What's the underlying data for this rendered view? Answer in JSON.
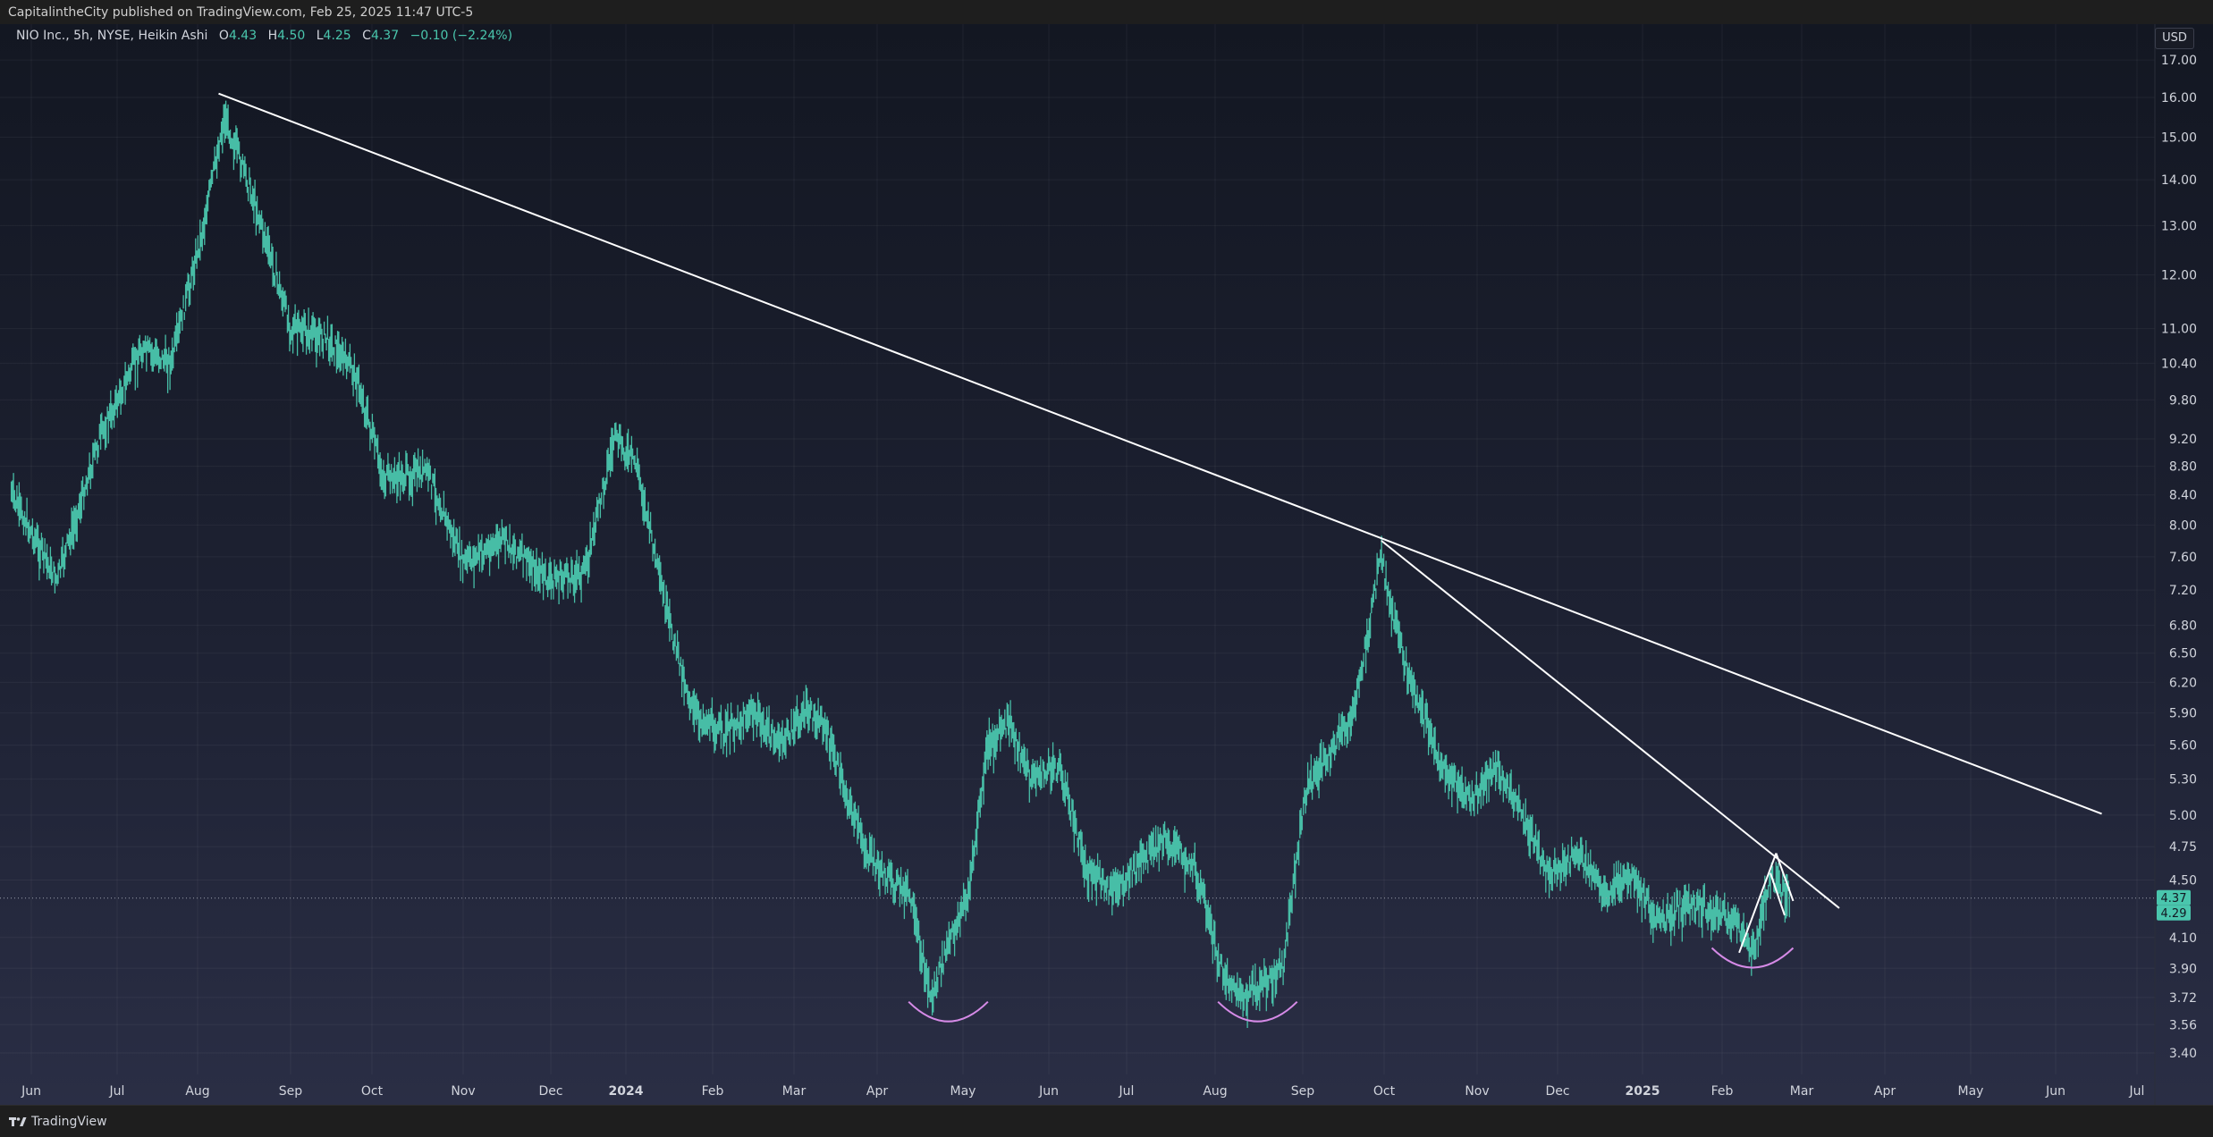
{
  "header": {
    "attribution": "CapitalintheCity published on TradingView.com, Feb 25, 2025 11:47 UTC-5"
  },
  "legend": {
    "symbol": "NIO Inc., 5h, NYSE, Heikin Ashi",
    "open_label": "O",
    "open_value": "4.43",
    "high_label": "H",
    "high_value": "4.50",
    "low_label": "L",
    "low_value": "4.25",
    "close_label": "C",
    "close_value": "4.37",
    "change": "−0.10 (−2.24%)"
  },
  "currency_button": "USD",
  "footer": {
    "brand": "TradingView"
  },
  "colors": {
    "candle": "#4ac6ad",
    "trendline": "#ffffff",
    "arc": "#d58ae6",
    "price_tag": "#4ac6ad"
  },
  "chart_data": {
    "type": "line",
    "title": "",
    "price_scale": "log",
    "x_axis_labels": [
      "Jun",
      "Jul",
      "Aug",
      "Sep",
      "Oct",
      "Nov",
      "Dec",
      "2024",
      "Feb",
      "Mar",
      "Apr",
      "May",
      "Jun",
      "Jul",
      "Aug",
      "Sep",
      "Oct",
      "Nov",
      "Dec",
      "2025",
      "Feb",
      "Mar",
      "Apr",
      "May",
      "Jun",
      "Jul"
    ],
    "x_axis_bold": [
      "2024",
      "2025"
    ],
    "y_axis_labels": [
      "17.00",
      "16.00",
      "15.00",
      "14.00",
      "13.00",
      "12.00",
      "11.00",
      "10.40",
      "9.80",
      "9.20",
      "8.80",
      "8.40",
      "8.00",
      "7.60",
      "7.20",
      "6.80",
      "6.50",
      "6.20",
      "5.90",
      "5.60",
      "5.30",
      "5.00",
      "4.75",
      "4.50",
      "4.10",
      "3.90",
      "3.72",
      "3.56",
      "3.40"
    ],
    "y_range": [
      3.3,
      17.3
    ],
    "series": [
      {
        "x": [
          "2023-05-25",
          "2023-06-10",
          "2023-06-25",
          "2023-07-10",
          "2023-07-22",
          "2023-08-03",
          "2023-08-10",
          "2023-08-20",
          "2023-09-01",
          "2023-09-15",
          "2023-09-25",
          "2023-10-05",
          "2023-10-20",
          "2023-11-01",
          "2023-11-15",
          "2023-11-30",
          "2023-12-15",
          "2023-12-27",
          "2024-01-05",
          "2024-01-15",
          "2024-01-25",
          "2024-02-05",
          "2024-02-15",
          "2024-02-25",
          "2024-03-05",
          "2024-03-12",
          "2024-03-20",
          "2024-03-28",
          "2024-04-05",
          "2024-04-12",
          "2024-04-20",
          "2024-04-25",
          "2024-05-03",
          "2024-05-10",
          "2024-05-18",
          "2024-05-25",
          "2024-06-05",
          "2024-06-15",
          "2024-06-25",
          "2024-07-05",
          "2024-07-15",
          "2024-07-25",
          "2024-08-03",
          "2024-08-10",
          "2024-08-18",
          "2024-08-25",
          "2024-09-02",
          "2024-09-10",
          "2024-09-20",
          "2024-09-30",
          "2024-10-03",
          "2024-10-10",
          "2024-10-20",
          "2024-10-30",
          "2024-11-08",
          "2024-11-18",
          "2024-11-28",
          "2024-12-08",
          "2024-12-18",
          "2024-12-28",
          "2025-01-08",
          "2025-01-15",
          "2025-01-25",
          "2025-02-05",
          "2025-02-12",
          "2025-02-18",
          "2025-02-25"
        ],
        "y": [
          8.4,
          7.3,
          9.2,
          10.6,
          10.4,
          13.0,
          15.5,
          13.5,
          11.0,
          10.8,
          10.2,
          8.6,
          8.7,
          7.5,
          7.8,
          7.3,
          7.4,
          9.2,
          8.8,
          7.0,
          5.9,
          5.7,
          5.9,
          5.6,
          5.9,
          5.8,
          5.2,
          4.7,
          4.5,
          4.4,
          3.7,
          4.0,
          4.4,
          5.6,
          5.8,
          5.3,
          5.4,
          4.6,
          4.4,
          4.6,
          4.8,
          4.6,
          3.9,
          3.7,
          3.8,
          3.9,
          5.2,
          5.5,
          5.9,
          7.6,
          7.0,
          6.2,
          5.4,
          5.1,
          5.4,
          5.0,
          4.5,
          4.7,
          4.4,
          4.5,
          4.2,
          4.3,
          4.3,
          4.2,
          4.0,
          4.5,
          4.37
        ]
      }
    ],
    "current_price": 4.37,
    "secondary_price": 4.29,
    "trendlines": [
      {
        "from": [
          "2023-08-08",
          16.1
        ],
        "to": [
          "2025-06-18",
          5.01
        ]
      },
      {
        "from": [
          "2024-09-30",
          7.8
        ],
        "to": [
          "2025-03-15",
          4.3
        ]
      },
      {
        "from": [
          "2025-02-07",
          4.0
        ],
        "to": [
          "2025-02-20",
          4.7
        ]
      },
      {
        "from": [
          "2025-02-20",
          4.7
        ],
        "to": [
          "2025-02-26",
          4.35
        ]
      },
      {
        "from": [
          "2025-02-18",
          4.55
        ],
        "to": [
          "2025-02-23",
          4.25
        ]
      }
    ],
    "arcs": [
      {
        "from": "2024-04-12",
        "to": "2024-05-10",
        "price": 3.62
      },
      {
        "from": "2024-08-02",
        "to": "2024-08-30",
        "price": 3.62
      },
      {
        "from": "2025-01-28",
        "to": "2025-02-26",
        "price": 3.95
      }
    ]
  }
}
